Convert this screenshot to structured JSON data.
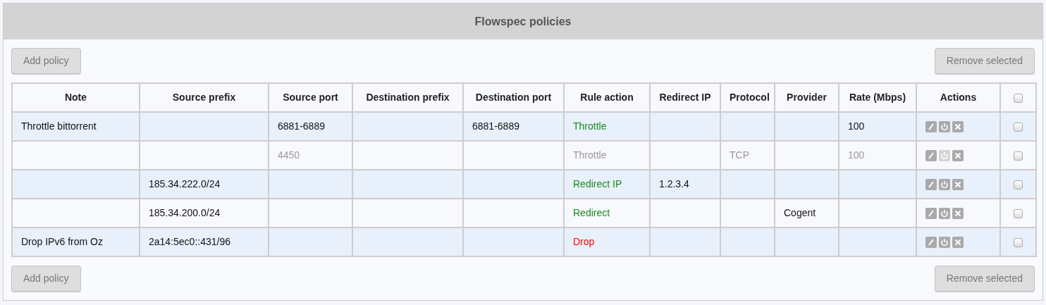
{
  "panel": {
    "title": "Flowspec policies"
  },
  "top_toolbar": {
    "add_button": {
      "label": "Add policy",
      "disabled": true
    },
    "remove_button": {
      "label": "Remove selected",
      "disabled": true
    }
  },
  "table": {
    "columns": [
      "Note",
      "Source prefix",
      "Source port",
      "Destination prefix",
      "Destination port",
      "Rule action",
      "Redirect IP",
      "Protocol",
      "Provider",
      "Rate (Mbps)",
      "Actions"
    ],
    "select_all": {
      "checked": false
    },
    "rows": [
      {
        "enabled": true,
        "checked": false,
        "cells": [
          "Throttle bittorrent",
          "",
          "6881-6889",
          "",
          "6881-6889",
          "Throttle",
          "",
          "",
          "",
          "100"
        ],
        "kind": "permit"
      },
      {
        "enabled": false,
        "checked": false,
        "cells": [
          "",
          "",
          "4450",
          "",
          "",
          "Throttle",
          "",
          "TCP",
          "",
          "100"
        ],
        "kind": "permit"
      },
      {
        "enabled": true,
        "checked": false,
        "cells": [
          "",
          "185.34.222.0/24",
          "",
          "",
          "",
          "Redirect IP",
          "1.2.3.4",
          "",
          "",
          ""
        ],
        "kind": "permit"
      },
      {
        "enabled": true,
        "checked": false,
        "cells": [
          "",
          "185.34.200.0/24",
          "",
          "",
          "",
          "Redirect",
          "",
          "",
          "Cogent",
          ""
        ],
        "kind": "permit"
      },
      {
        "enabled": true,
        "checked": false,
        "cells": [
          "Drop IPv6 from Oz",
          "2a14:5ec0::431/96",
          "",
          "",
          "",
          "Drop",
          "",
          "",
          "",
          ""
        ],
        "kind": "drop"
      }
    ]
  },
  "bottom_toolbar": {
    "add_button": {
      "label": "Add policy",
      "disabled": true
    },
    "remove_button": {
      "label": "Remove selected",
      "disabled": true
    }
  }
}
